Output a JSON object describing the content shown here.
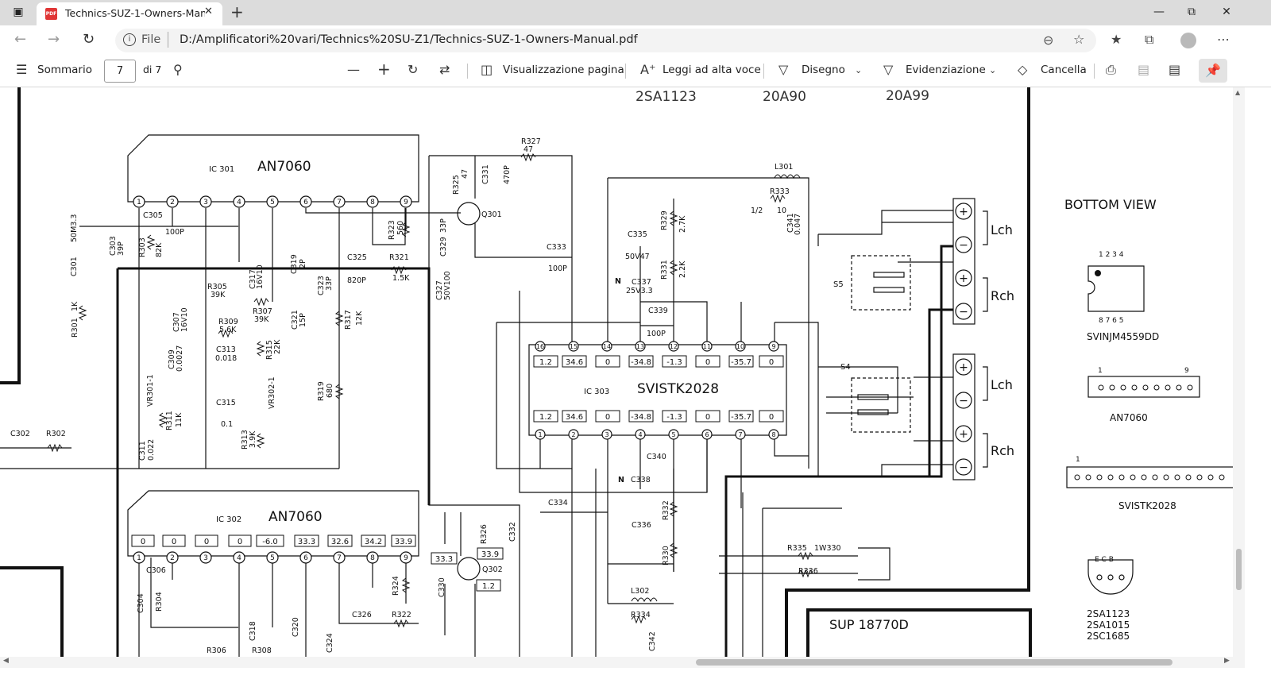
{
  "browser": {
    "tab_title": "Technics-SUZ-1-Owners-Manual.pdf",
    "tab_icon_text": "PDF",
    "url_scheme": "File",
    "url": "D:/Amplificatori%20vari/Technics%20SU-Z1/Technics-SUZ-1-Owners-Manual.pdf"
  },
  "toolbar": {
    "contents_label": "Sommario",
    "page_current": "7",
    "page_total": "di 7",
    "page_view_label": "Visualizzazione pagina",
    "read_aloud_label": "Leggi ad alta voce",
    "draw_label": "Disegno",
    "highlight_label": "Evidenziazione",
    "erase_label": "Cancella"
  },
  "schematic": {
    "header_transistors": [
      "2SA1123",
      "20A90",
      "20A99"
    ],
    "ic301": {
      "ref": "IC 301",
      "part": "AN7060",
      "pins": [
        "1",
        "2",
        "3",
        "4",
        "5",
        "6",
        "7",
        "8",
        "9"
      ]
    },
    "ic302": {
      "ref": "IC 302",
      "part": "AN7060",
      "voltages": [
        "0",
        "0",
        "0",
        "0",
        "-6.0",
        "33.3",
        "32.6",
        "34.2",
        "33.9"
      ]
    },
    "ic303": {
      "ref": "IC 303",
      "part": "SVISTK2028",
      "top_pins": [
        "16",
        "15",
        "14",
        "13",
        "12",
        "11",
        "10",
        "9"
      ],
      "bottom_pins": [
        "1",
        "2",
        "3",
        "4",
        "5",
        "6",
        "7",
        "8"
      ],
      "voltages": [
        "1.2",
        "34.6",
        "0",
        "-34.8",
        "-1.3",
        "0",
        "-35.7",
        "0"
      ]
    },
    "q301": "Q301",
    "q302": "Q302",
    "q302_voltages": [
      "33.3",
      "33.9",
      "1.2"
    ],
    "components": {
      "r327": "R327",
      "r327_val": "47",
      "r325": "R325",
      "r325_val": "47",
      "c331": "C331",
      "c331_val": "470P",
      "l301": "L301",
      "r333": "R333",
      "r333_val": "10",
      "half": "1/2",
      "c341": "C341",
      "c341_val": "0.047",
      "c305": "C305",
      "c305_val": "100P",
      "c301": "C301",
      "c301_val": "50M3.3",
      "c303": "C303",
      "c303_val": "39P",
      "r303": "R303",
      "r303_val": "82K",
      "r323": "R323",
      "r323_val": "560",
      "c329": "C329",
      "c329_val": "33P",
      "r329": "R329",
      "r329_val": "2.7K",
      "c335": "C335",
      "c335_val": "50V47",
      "c333": "C333",
      "c333_val": "100P",
      "r331": "R331",
      "r331_val": "2.2K",
      "c317": "C317",
      "c317_val": "16V10",
      "c319": "C319",
      "c319_val": "2P",
      "c325": "C325",
      "c325_val": "820P",
      "r321": "R321",
      "r321_val": "1.5K",
      "c327": "C327",
      "c327_val": "50V100",
      "c323": "C323",
      "c323_val": "33P",
      "r305": "R305",
      "r305_val": "39K",
      "c337": "C337",
      "c337_val": "25V3.3",
      "c339": "C339",
      "c339_val": "100P",
      "r301": "R301",
      "r301_val": "1K",
      "c307": "C307",
      "c307_val": "16V10",
      "r309": "R309",
      "r309_val": "5.6K",
      "r307": "R307",
      "r307_val": "39K",
      "c321": "C321",
      "c321_val": "15P",
      "r317": "R317",
      "r317_val": "12K",
      "c309": "C309",
      "c309_val": "0.0027",
      "c313": "C313",
      "c313_val": "0.018",
      "r315": "R315",
      "r315_val": "22K",
      "vr301": "VR301-1",
      "vr302": "VR302-1",
      "r319": "R319",
      "r319_val": "680",
      "c315": "C315",
      "c315_val": "0.1",
      "r311": "R311",
      "r311_val": "11K",
      "r313": "R313",
      "r313_val": "3.9K",
      "c302": "C302",
      "r302": "R302",
      "c311": "C311",
      "c311_val": "0.022",
      "c340": "C340",
      "c338": "C338",
      "c334": "C334",
      "r332": "R332",
      "c336": "C336",
      "r330": "R330",
      "c306": "C306",
      "r326": "R326",
      "c332": "C332",
      "c304": "C304",
      "r304": "R304",
      "r324": "R324",
      "c330": "C330",
      "c326": "C326",
      "r322": "R322",
      "c318": "C318",
      "c320": "C320",
      "c324": "C324",
      "r306": "R306",
      "r308": "R308",
      "l302": "L302",
      "r334": "R334",
      "c342": "C342",
      "r335": "R335",
      "r335_val": "1W330",
      "r336": "R336",
      "sup": "SUP 18770D",
      "n_mark": "N"
    },
    "switches": [
      "S5",
      "S4"
    ],
    "outputs": [
      "Lch",
      "Rch",
      "Lch",
      "Rch"
    ],
    "bottom_view": {
      "title": "BOTTOM   VIEW",
      "top_pins": "1 2 3 4",
      "bottom_pins": "8 7 6 5",
      "ic_a": "SVINJM4559DD",
      "an_pin1": "1",
      "an_pin9": "9",
      "ic_b": "AN7060",
      "sv_pin1": "1",
      "ic_c": "SVISTK2028",
      "ecb": "E C B",
      "transistors": [
        "2SA1123",
        "2SA1015",
        "2SC1685"
      ]
    }
  }
}
